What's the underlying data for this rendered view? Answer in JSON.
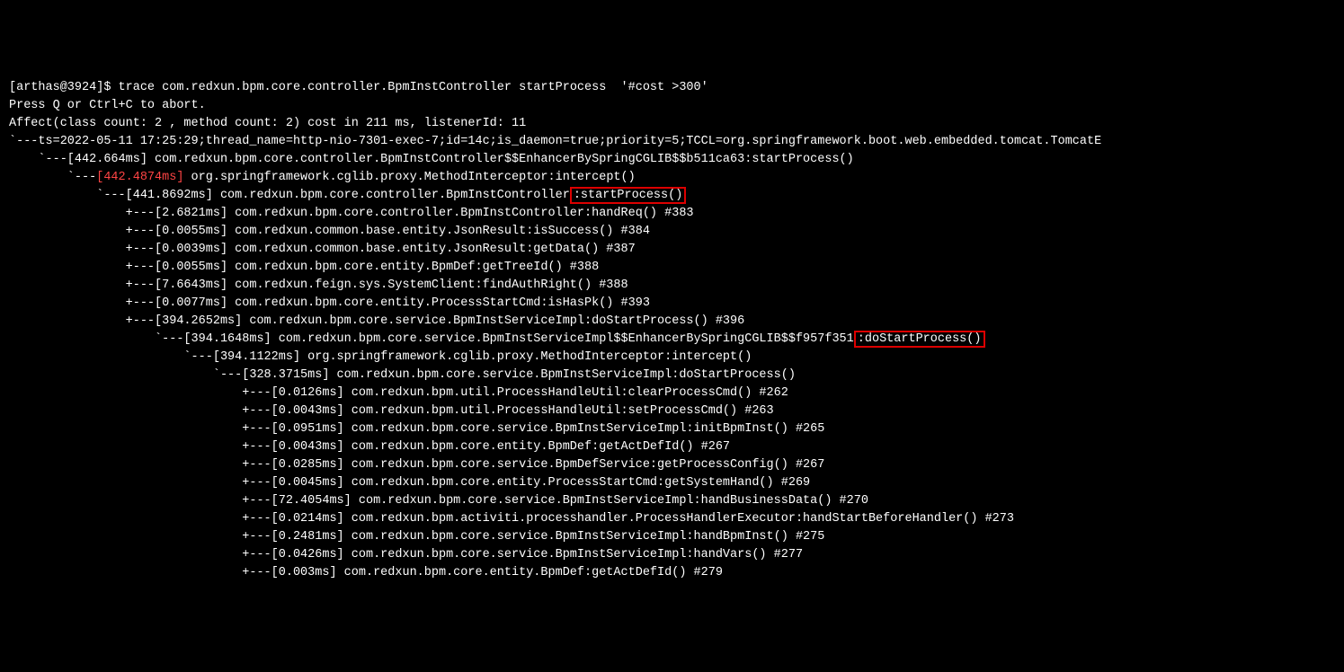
{
  "prompt": "[arthas@3924]$ ",
  "command": "trace com.redxun.bpm.core.controller.BpmInstController startProcess  '#cost >300'",
  "l2": "Press Q or Ctrl+C to abort.",
  "l3": "Affect(class count: 2 , method count: 2) cost in 211 ms, listenerId: 11",
  "l4": "`---ts=2022-05-11 17:25:29;thread_name=http-nio-7301-exec-7;id=14c;is_daemon=true;priority=5;TCCL=org.springframework.boot.web.embedded.tomcat.TomcatE",
  "l5": "    `---[442.664ms] com.redxun.bpm.core.controller.BpmInstController$$EnhancerBySpringCGLIB$$b511ca63:startProcess()",
  "l6a": "        `---",
  "l6b": "[442.4874ms]",
  "l6c": " org.springframework.cglib.proxy.MethodInterceptor:intercept()",
  "l7a": "            `---[441.8692ms] com.redxun.bpm.core.controller.BpmInstController",
  "l7b": ":startProcess()",
  "l8": "                +---[2.6821ms] com.redxun.bpm.core.controller.BpmInstController:handReq() #383",
  "l9": "                +---[0.0055ms] com.redxun.common.base.entity.JsonResult:isSuccess() #384",
  "l10": "                +---[0.0039ms] com.redxun.common.base.entity.JsonResult:getData() #387",
  "l11": "                +---[0.0055ms] com.redxun.bpm.core.entity.BpmDef:getTreeId() #388",
  "l12": "                +---[7.6643ms] com.redxun.feign.sys.SystemClient:findAuthRight() #388",
  "l13": "                +---[0.0077ms] com.redxun.bpm.core.entity.ProcessStartCmd:isHasPk() #393",
  "l14": "                +---[394.2652ms] com.redxun.bpm.core.service.BpmInstServiceImpl:doStartProcess() #396",
  "l15a": "                    `---[394.1648ms] com.redxun.bpm.core.service.BpmInstServiceImpl$$EnhancerBySpringCGLIB$$f957f351",
  "l15b": ":doStartProcess()",
  "l16": "                        `---[394.1122ms] org.springframework.cglib.proxy.MethodInterceptor:intercept()",
  "l17": "                            `---[328.3715ms] com.redxun.bpm.core.service.BpmInstServiceImpl:doStartProcess()",
  "l18": "                                +---[0.0126ms] com.redxun.bpm.util.ProcessHandleUtil:clearProcessCmd() #262",
  "l19": "                                +---[0.0043ms] com.redxun.bpm.util.ProcessHandleUtil:setProcessCmd() #263",
  "l20": "                                +---[0.0951ms] com.redxun.bpm.core.service.BpmInstServiceImpl:initBpmInst() #265",
  "l21": "                                +---[0.0043ms] com.redxun.bpm.core.entity.BpmDef:getActDefId() #267",
  "l22": "                                +---[0.0285ms] com.redxun.bpm.core.service.BpmDefService:getProcessConfig() #267",
  "l23": "                                +---[0.0045ms] com.redxun.bpm.core.entity.ProcessStartCmd:getSystemHand() #269",
  "l24": "                                +---[72.4054ms] com.redxun.bpm.core.service.BpmInstServiceImpl:handBusinessData() #270",
  "l25": "                                +---[0.0214ms] com.redxun.bpm.activiti.processhandler.ProcessHandlerExecutor:handStartBeforeHandler() #273",
  "l26": "                                +---[0.2481ms] com.redxun.bpm.core.service.BpmInstServiceImpl:handBpmInst() #275",
  "l27": "                                +---[0.0426ms] com.redxun.bpm.core.service.BpmInstServiceImpl:handVars() #277",
  "l28": "                                +---[0.003ms] com.redxun.bpm.core.entity.BpmDef:getActDefId() #279"
}
